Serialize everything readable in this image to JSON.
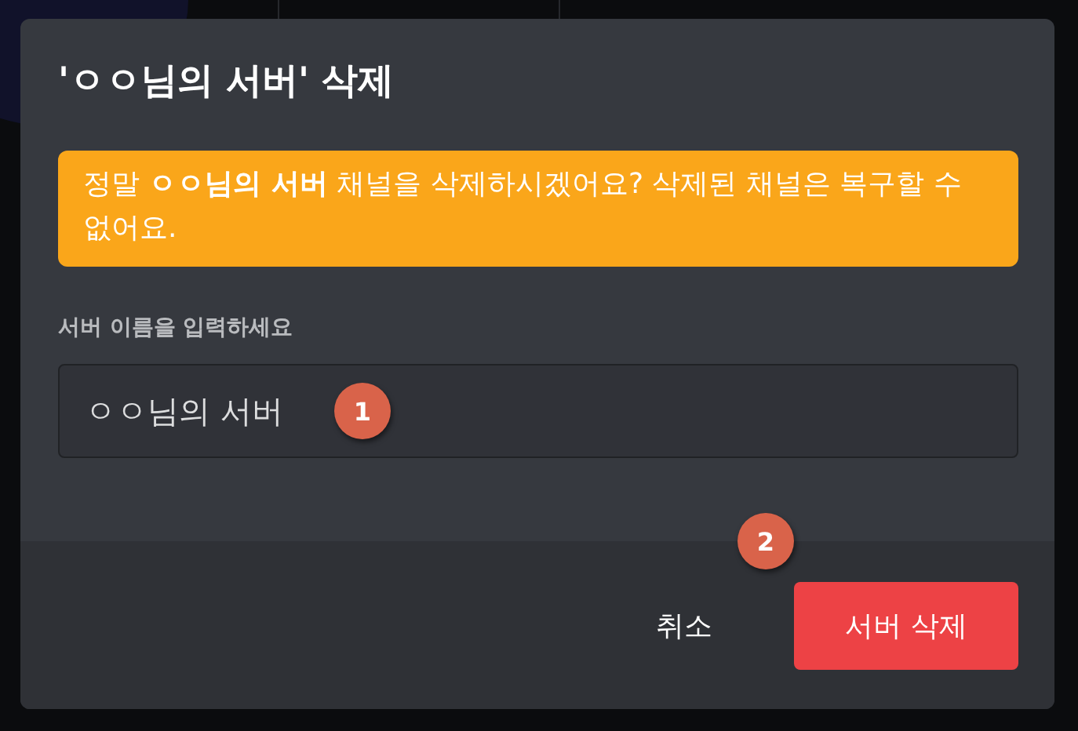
{
  "dialog": {
    "title": "'ㅇㅇ님의 서버' 삭제",
    "warning": "정말 **ㅇㅇ님의 서버** 채널을 삭제하시겠어요? 삭제된 채널은 복구할 수 없어요.",
    "field": {
      "label": "서버 이름을 입력하세요",
      "value": "ㅇㅇ님의 서버"
    },
    "buttons": [
      {
        "kind": "cancel",
        "label": "취소"
      },
      {
        "kind": "danger",
        "label": "서버 삭제"
      }
    ]
  },
  "markers": [
    {
      "label": "1"
    },
    {
      "label": "2"
    }
  ]
}
